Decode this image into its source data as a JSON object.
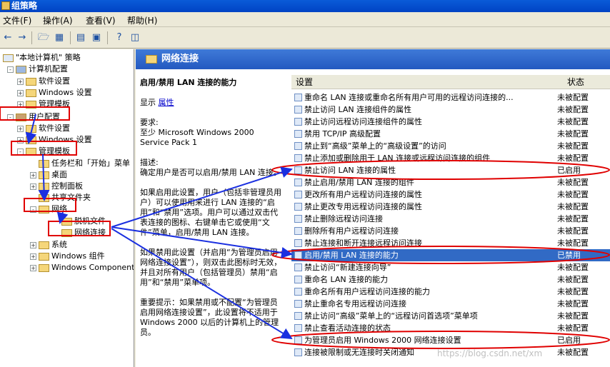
{
  "window": {
    "title": "组策略"
  },
  "menu": [
    "文件(F)",
    "操作(A)",
    "查看(V)",
    "帮助(H)"
  ],
  "toolbar": [
    "back-icon",
    "forward-icon",
    "up-folder-icon",
    "show-tree-icon",
    "properties-icon",
    "export-icon",
    "help-icon",
    "view-icon"
  ],
  "tree": [
    {
      "label": "\"本地计算机\" 策略",
      "indent": 0,
      "expander": "",
      "icon": "policy"
    },
    {
      "label": "计算机配置",
      "indent": 1,
      "expander": "-",
      "icon": "computer"
    },
    {
      "label": "软件设置",
      "indent": 2,
      "expander": "+",
      "icon": "folder"
    },
    {
      "label": "Windows 设置",
      "indent": 2,
      "expander": "+",
      "icon": "folder"
    },
    {
      "label": "管理模板",
      "indent": 2,
      "expander": "+",
      "icon": "folder"
    },
    {
      "label": "用户配置",
      "indent": 1,
      "expander": "-",
      "icon": "user"
    },
    {
      "label": "软件设置",
      "indent": 2,
      "expander": "+",
      "icon": "folder"
    },
    {
      "label": "Windows 设置",
      "indent": 2,
      "expander": "+",
      "icon": "folder"
    },
    {
      "label": "管理模板",
      "indent": 2,
      "expander": "-",
      "icon": "folder"
    },
    {
      "label": "任务栏和「开始」菜单",
      "indent": 3,
      "expander": "",
      "icon": "folder"
    },
    {
      "label": "桌面",
      "indent": 3,
      "expander": "+",
      "icon": "folder"
    },
    {
      "label": "控制面板",
      "indent": 3,
      "expander": "+",
      "icon": "folder"
    },
    {
      "label": "共享文件夹",
      "indent": 3,
      "expander": "",
      "icon": "folder"
    },
    {
      "label": "网络",
      "indent": 3,
      "expander": "-",
      "icon": "folder"
    },
    {
      "label": "脱机文件",
      "indent": 4,
      "expander": "",
      "icon": "folder"
    },
    {
      "label": "网络连接",
      "indent": 4,
      "expander": "",
      "icon": "folder"
    },
    {
      "label": "系统",
      "indent": 3,
      "expander": "+",
      "icon": "folder"
    },
    {
      "label": "Windows 组件",
      "indent": 3,
      "expander": "+",
      "icon": "folder"
    },
    {
      "label": "Windows Components",
      "indent": 3,
      "expander": "+",
      "icon": "folder"
    }
  ],
  "panel": {
    "title": "网络连接"
  },
  "description": {
    "title": "启用/禁用 LAN 连接的能力",
    "show": "显示",
    "properties_link": "属性",
    "requirement_label": "要求:",
    "requirement": "至少 Microsoft Windows 2000 Service Pack 1",
    "desc_label": "描述:",
    "desc_1": "确定用户是否可以启用/禁用 LAN 连接。",
    "desc_2": "如果启用此设置，用户（包括非管理员用户）可以使用用来进行 LAN 连接的“启用”和“禁用”选项。用户可以通过双击代表连接的图标、右键单击它或使用“文件”菜单，启用/禁用 LAN 连接。",
    "desc_3": "如果禁用此设置（并启用“为管理员启用网络连接设置”），则双击此图标时无效，并且对所有用户（包括管理员）禁用“启用”和“禁用”菜单项。",
    "desc_4": "重要提示：如果禁用或不配置“为管理员启用网络连接设置”，此设置将不适用于 Windows 2000 以后的计算机上的管理员。"
  },
  "list": {
    "col_setting": "设置",
    "col_state": "状态",
    "rows": [
      {
        "name": "重命名 LAN 连接或重命名所有用户可用的远程访问连接的...",
        "state": "未被配置"
      },
      {
        "name": "禁止访问 LAN 连接组件的属性",
        "state": "未被配置"
      },
      {
        "name": "禁止访问远程访问连接组件的属性",
        "state": "未被配置"
      },
      {
        "name": "禁用 TCP/IP 高级配置",
        "state": "未被配置"
      },
      {
        "name": "禁止到“高级”菜单上的“高级设置”的访问",
        "state": "未被配置"
      },
      {
        "name": "禁止添加或删除用于 LAN 连接或远程访问连接的组件",
        "state": "未被配置"
      },
      {
        "name": "禁止访问 LAN 连接的属性",
        "state": "已启用"
      },
      {
        "name": "禁止启用/禁用 LAN 连接的组件",
        "state": "未被配置"
      },
      {
        "name": "更改所有用户远程访问连接的属性",
        "state": "未被配置"
      },
      {
        "name": "禁止更改专用远程访问连接的属性",
        "state": "未被配置"
      },
      {
        "name": "禁止删除远程访问连接",
        "state": "未被配置"
      },
      {
        "name": "删除所有用户远程访问连接",
        "state": "未被配置"
      },
      {
        "name": "禁止连接和断开连接远程访问连接",
        "state": "未被配置"
      },
      {
        "name": "启用/禁用 LAN 连接的能力",
        "state": "已禁用",
        "selected": true
      },
      {
        "name": "禁止访问“新建连接向导”",
        "state": "未被配置"
      },
      {
        "name": "重命名 LAN 连接的能力",
        "state": "未被配置"
      },
      {
        "name": "重命名所有用户远程访问连接的能力",
        "state": "未被配置"
      },
      {
        "name": "禁止重命名专用远程访问连接",
        "state": "未被配置"
      },
      {
        "name": "禁止访问“高级”菜单上的“远程访问首选项”菜单项",
        "state": "未被配置"
      },
      {
        "name": "禁止查看活动连接的状态",
        "state": "未被配置"
      },
      {
        "name": "为管理员启用 Windows 2000 网络连接设置",
        "state": "已启用"
      },
      {
        "name": "连接被限制或无连接时关闭通知",
        "state": "未被配置"
      }
    ]
  },
  "watermark": "https://blog.csdn.net/xm",
  "colors": {
    "annotation_red": "#e00000",
    "annotation_blue": "#1a2fe0",
    "selection": "#316ac5"
  }
}
